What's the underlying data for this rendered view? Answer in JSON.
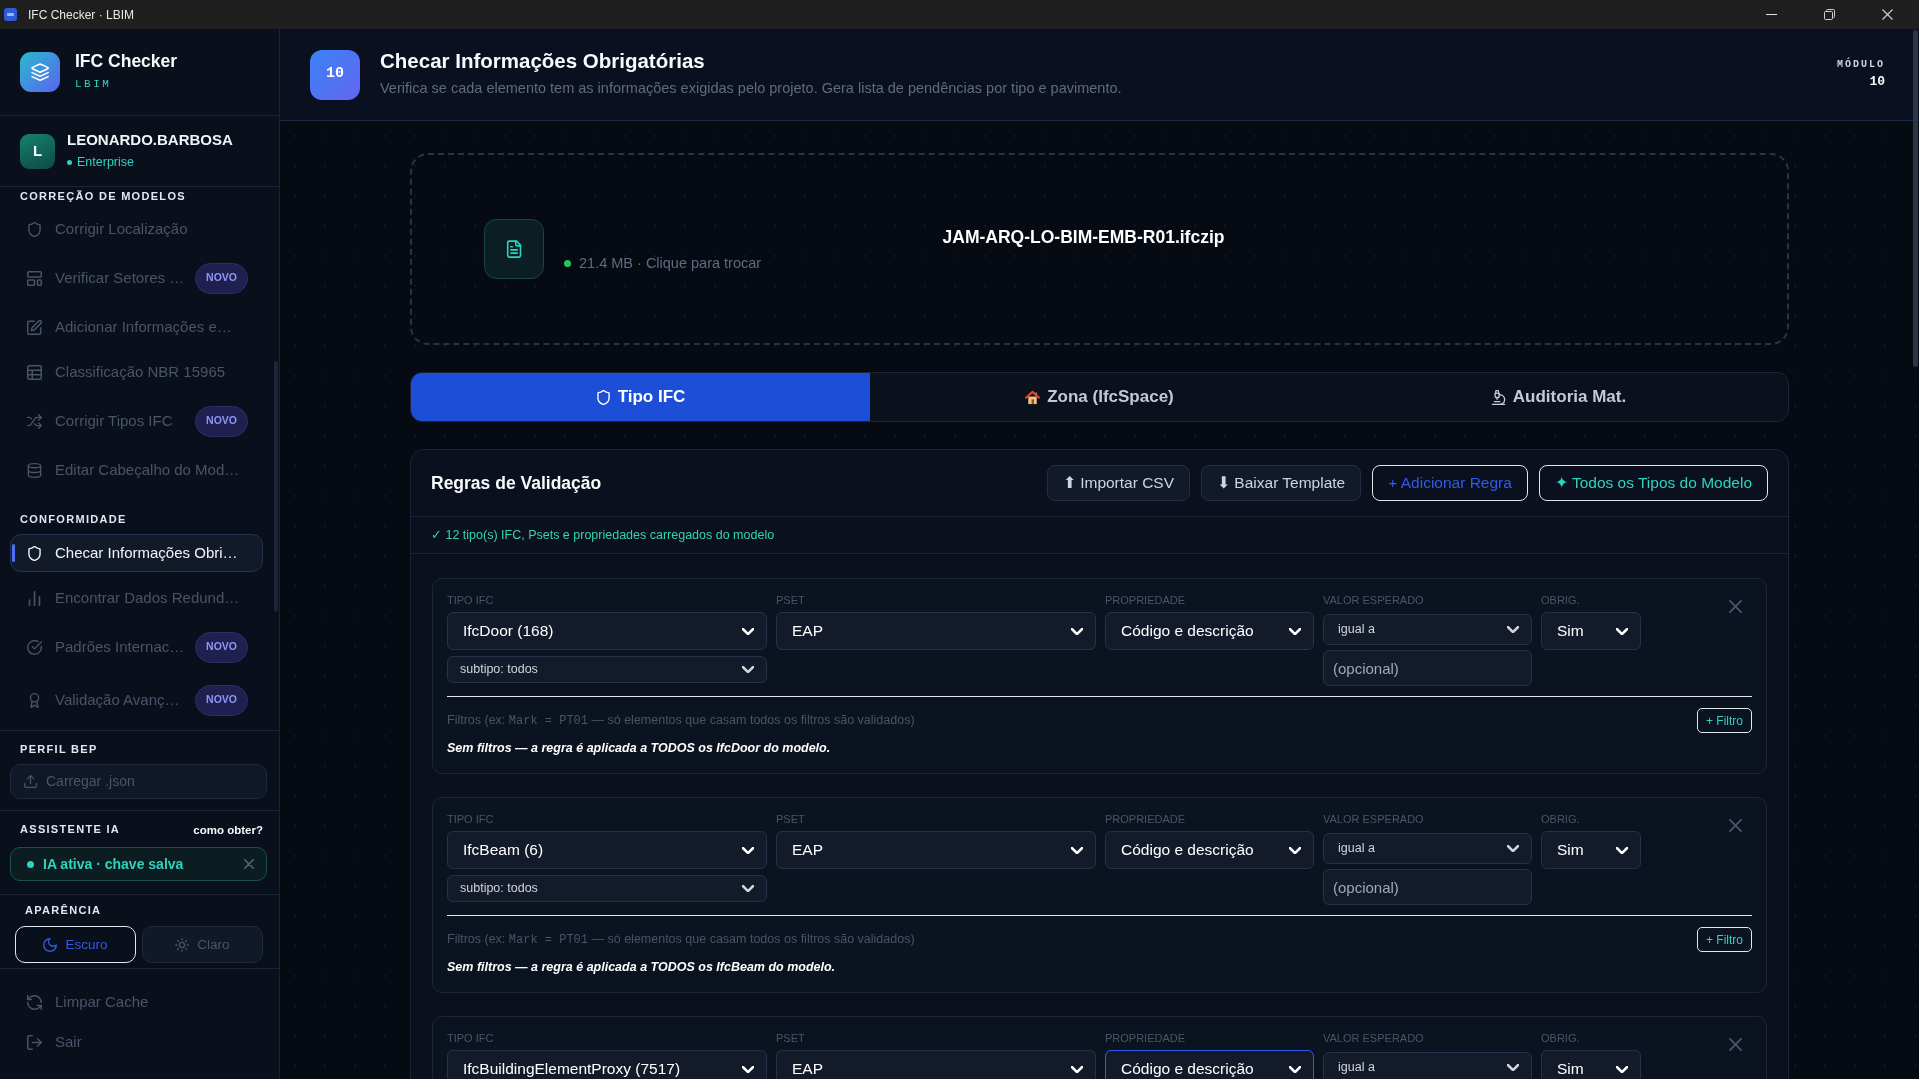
{
  "window": {
    "title": "IFC Checker · LBIM"
  },
  "sidebar": {
    "brand": {
      "name": "IFC Checker",
      "subtitle": "LBIM"
    },
    "user": {
      "initial": "L",
      "name": "LEONARDO.BARBOSA",
      "plan": "Enterprise"
    },
    "sections": [
      {
        "title": "CORREÇÃO DE MODELOS",
        "items": [
          {
            "label": "Corrigir Localização",
            "selected": false
          },
          {
            "label": "Verificar Setores …",
            "badge": "NOVO",
            "selected": false
          },
          {
            "label": "Adicionar Informações e…",
            "selected": false
          },
          {
            "label": "Classificação NBR 15965",
            "selected": false
          },
          {
            "label": "Corrigir Tipos IFC",
            "badge": "NOVO",
            "selected": false
          },
          {
            "label": "Editar Cabeçalho do Mod…",
            "selected": false
          }
        ]
      },
      {
        "title": "CONFORMIDADE",
        "items": [
          {
            "label": "Checar Informações Obri…",
            "selected": true
          },
          {
            "label": "Encontrar Dados Redund…",
            "selected": false
          },
          {
            "label": "Padrões Internac…",
            "badge": "NOVO",
            "selected": false
          },
          {
            "label": "Validação Avanç…",
            "badge": "NOVO",
            "selected": false
          }
        ]
      }
    ],
    "bep_profile": {
      "title": "PERFIL BEP",
      "button": "Carregar .json"
    },
    "ai_assistant": {
      "title": "ASSISTENTE IA",
      "link": "como obter?",
      "status": "IA ativa · chave salva",
      "active": true
    },
    "appearance": {
      "title": "APARÊNCIA",
      "options": [
        {
          "label": "Escuro",
          "selected": true
        },
        {
          "label": "Claro",
          "selected": false
        }
      ]
    },
    "footer_items": [
      {
        "label": "Limpar Cache"
      },
      {
        "label": "Sair"
      }
    ]
  },
  "header": {
    "badge": "10",
    "title": "Checar Informações Obrigatórias",
    "description": "Verifica se cada elemento tem as informações exigidas pelo projeto. Gera lista de pendências por tipo e pavimento.",
    "module_label": "MÓDULO",
    "module_number": "10"
  },
  "file": {
    "name": "JAM-ARQ-LO-BIM-EMB-R01.ifczip",
    "meta": "21.4 MB · Clique para trocar"
  },
  "tabs": [
    {
      "label": "Tipo IFC",
      "selected": true
    },
    {
      "label": "Zona (IfcSpace)",
      "selected": false
    },
    {
      "label": "Auditoria Mat.",
      "selected": false
    }
  ],
  "rules_panel": {
    "title": "Regras de Validação",
    "actions": [
      {
        "label": "⬆ Importar CSV",
        "kind": "secondary"
      },
      {
        "label": "⬇ Baixar Template",
        "kind": "secondary"
      },
      {
        "label": "+ Adicionar Regra",
        "kind": "primary"
      },
      {
        "label": "✦ Todos os Tipos do Modelo",
        "kind": "accent"
      }
    ],
    "status": "✓ 12 tipo(s) IFC, Psets e propriedades carregados do modelo",
    "rules": [
      {
        "tipo_ifc": {
          "label": "TIPO IFC",
          "value": "IfcDoor (168)",
          "subtype": "subtipo: todos"
        },
        "pset": {
          "label": "PSET",
          "value": "EAP"
        },
        "property": {
          "label": "PROPRIEDADE",
          "value": "Código e descrição",
          "focused": false
        },
        "expected_value": {
          "label": "VALOR ESPERADO",
          "operator": "igual a",
          "placeholder": "(opcional)"
        },
        "required": {
          "label": "OBRIG.",
          "value": "Sim"
        },
        "filters_hint": {
          "text_before": "Filtros (ex: ",
          "code": "Mark = PT01",
          "text_after": " — só elementos que casam todos os filtros são validados)"
        },
        "add_filter": "+ Filtro",
        "note": "Sem filtros — a regra é aplicada a TODOS os IfcDoor do modelo."
      },
      {
        "tipo_ifc": {
          "label": "TIPO IFC",
          "value": "IfcBeam (6)",
          "subtype": "subtipo: todos"
        },
        "pset": {
          "label": "PSET",
          "value": "EAP"
        },
        "property": {
          "label": "PROPRIEDADE",
          "value": "Código e descrição",
          "focused": false
        },
        "expected_value": {
          "label": "VALOR ESPERADO",
          "operator": "igual a",
          "placeholder": "(opcional)"
        },
        "required": {
          "label": "OBRIG.",
          "value": "Sim"
        },
        "filters_hint": {
          "text_before": "Filtros (ex: ",
          "code": "Mark = PT01",
          "text_after": " — só elementos que casam todos os filtros são validados)"
        },
        "add_filter": "+ Filtro",
        "note": "Sem filtros — a regra é aplicada a TODOS os IfcBeam do modelo."
      },
      {
        "tipo_ifc": {
          "label": "TIPO IFC",
          "value": "IfcBuildingElementProxy (7517)"
        },
        "pset": {
          "label": "PSET",
          "value": "EAP"
        },
        "property": {
          "label": "PROPRIEDADE",
          "value": "Código e descrição",
          "focused": true
        },
        "expected_value": {
          "label": "VALOR ESPERADO",
          "operator": "igual a"
        },
        "required": {
          "label": "OBRIG.",
          "value": "Sim"
        }
      }
    ]
  }
}
